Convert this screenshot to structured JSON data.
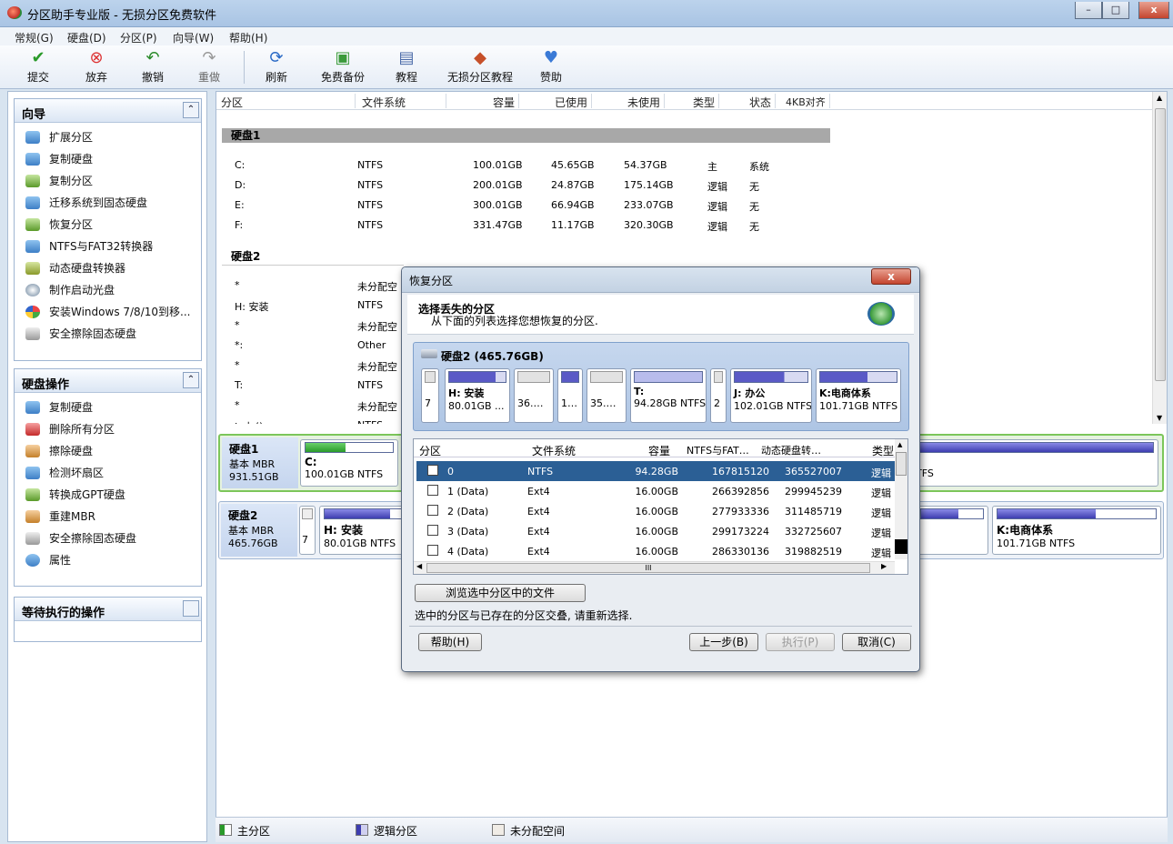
{
  "window": {
    "title": "分区助手专业版 - 无损分区免费软件",
    "minimize": "–",
    "maximize": "□",
    "close": "x"
  },
  "menu": [
    "常规(G)",
    "硬盘(D)",
    "分区(P)",
    "向导(W)",
    "帮助(H)"
  ],
  "toolbar": {
    "commit": "提交",
    "discard": "放弃",
    "undo": "撤销",
    "redo": "重做",
    "refresh": "刷新",
    "backup": "免费备份",
    "tutorial": "教程",
    "lossless_tutorial": "无损分区教程",
    "donate": "赞助"
  },
  "wizard": {
    "title": "向导",
    "items": [
      "扩展分区",
      "复制硬盘",
      "复制分区",
      "迁移系统到固态硬盘",
      "恢复分区",
      "NTFS与FAT32转换器",
      "动态硬盘转换器",
      "制作启动光盘",
      "安装Windows 7/8/10到移...",
      "安全擦除固态硬盘"
    ]
  },
  "disk_ops": {
    "title": "硬盘操作",
    "items": [
      "复制硬盘",
      "删除所有分区",
      "擦除硬盘",
      "检测坏扇区",
      "转换成GPT硬盘",
      "重建MBR",
      "安全擦除固态硬盘",
      "属性"
    ]
  },
  "pending": {
    "title": "等待执行的操作"
  },
  "columns": [
    "分区",
    "文件系统",
    "容量",
    "已使用",
    "未使用",
    "类型",
    "状态",
    "4KB对齐"
  ],
  "disk1": {
    "label": "硬盘1",
    "rows": [
      {
        "part": "C:",
        "fs": "NTFS",
        "cap": "100.01GB",
        "used": "45.65GB",
        "free": "54.37GB",
        "type": "主",
        "status": "系统"
      },
      {
        "part": "D:",
        "fs": "NTFS",
        "cap": "200.01GB",
        "used": "24.87GB",
        "free": "175.14GB",
        "type": "逻辑",
        "status": "无"
      },
      {
        "part": "E:",
        "fs": "NTFS",
        "cap": "300.01GB",
        "used": "66.94GB",
        "free": "233.07GB",
        "type": "逻辑",
        "status": "无"
      },
      {
        "part": "F:",
        "fs": "NTFS",
        "cap": "331.47GB",
        "used": "11.17GB",
        "free": "320.30GB",
        "type": "逻辑",
        "status": "无"
      }
    ]
  },
  "disk2": {
    "label": "硬盘2",
    "rows": [
      {
        "part": "*",
        "fs": "未分配空"
      },
      {
        "part": "H: 安装",
        "fs": "NTFS"
      },
      {
        "part": "*",
        "fs": "未分配空"
      },
      {
        "part": "*:",
        "fs": "Other"
      },
      {
        "part": "*",
        "fs": "未分配空"
      },
      {
        "part": "T:",
        "fs": "NTFS"
      },
      {
        "part": "*",
        "fs": "未分配空"
      },
      {
        "part": "J: 办公",
        "fs": "NTFS"
      }
    ]
  },
  "map": {
    "disk1": {
      "name": "硬盘1",
      "kind": "基本 MBR",
      "size": "931.51GB",
      "c_name": "C:",
      "c_info": "100.01GB NTFS",
      "tail_info": "TFS",
      "c_used": 0.46
    },
    "disk2": {
      "name": "硬盘2",
      "kind": "基本 MBR",
      "size": "465.76GB",
      "small": "7",
      "h_name": "H: 安装",
      "h_info": "80.01GB NTFS",
      "k_name": "K:电商体系",
      "k_info": "101.71GB NTFS",
      "h_used": 0.82,
      "k_used": 0.62
    }
  },
  "legend": {
    "primary": "主分区",
    "logical": "逻辑分区",
    "unalloc": "未分配空间"
  },
  "dialog": {
    "title": "恢复分区",
    "close": "x",
    "heading": "选择丢失的分区",
    "subheading": "从下面的列表选择您想恢复的分区.",
    "disk_title": "硬盘2 (465.76GB)",
    "blocks": [
      {
        "name": "",
        "info": "7"
      },
      {
        "name": "H: 安装",
        "info": "80.01GB ..."
      },
      {
        "name": "",
        "info": "36.…"
      },
      {
        "name": "",
        "info": "1…"
      },
      {
        "name": "",
        "info": "35.…"
      },
      {
        "name": "T:",
        "info": "94.28GB NTFS"
      },
      {
        "name": "",
        "info": "2"
      },
      {
        "name": "J: 办公",
        "info": "102.01GB NTFS"
      },
      {
        "name": "K:电商体系",
        "info": "101.71GB NTFS"
      }
    ],
    "columns": [
      "分区",
      "文件系统",
      "容量",
      "NTFS与FAT…",
      "动态硬盘转…",
      "类型"
    ],
    "rows": [
      {
        "part": "0",
        "fs": "NTFS",
        "cap": "94.28GB",
        "a": "167815120",
        "b": "365527007",
        "type": "逻辑"
      },
      {
        "part": "1 (Data)",
        "fs": "Ext4",
        "cap": "16.00GB",
        "a": "266392856",
        "b": "299945239",
        "type": "逻辑"
      },
      {
        "part": "2 (Data)",
        "fs": "Ext4",
        "cap": "16.00GB",
        "a": "277933336",
        "b": "311485719",
        "type": "逻辑"
      },
      {
        "part": "3 (Data)",
        "fs": "Ext4",
        "cap": "16.00GB",
        "a": "299173224",
        "b": "332725607",
        "type": "逻辑"
      },
      {
        "part": "4 (Data)",
        "fs": "Ext4",
        "cap": "16.00GB",
        "a": "286330136",
        "b": "319882519",
        "type": "逻辑"
      }
    ],
    "hscroll_grip": "III",
    "browse": "浏览选中分区中的文件",
    "message": "选中的分区与已存在的分区交叠, 请重新选择.",
    "help": "帮助(H)",
    "back": "上一步(B)",
    "execute": "执行(P)",
    "cancel": "取消(C)"
  },
  "colors": {
    "accent": "#2b5f95",
    "primary_part": "#2a9a2a",
    "logical_part": "#3d3db0"
  }
}
